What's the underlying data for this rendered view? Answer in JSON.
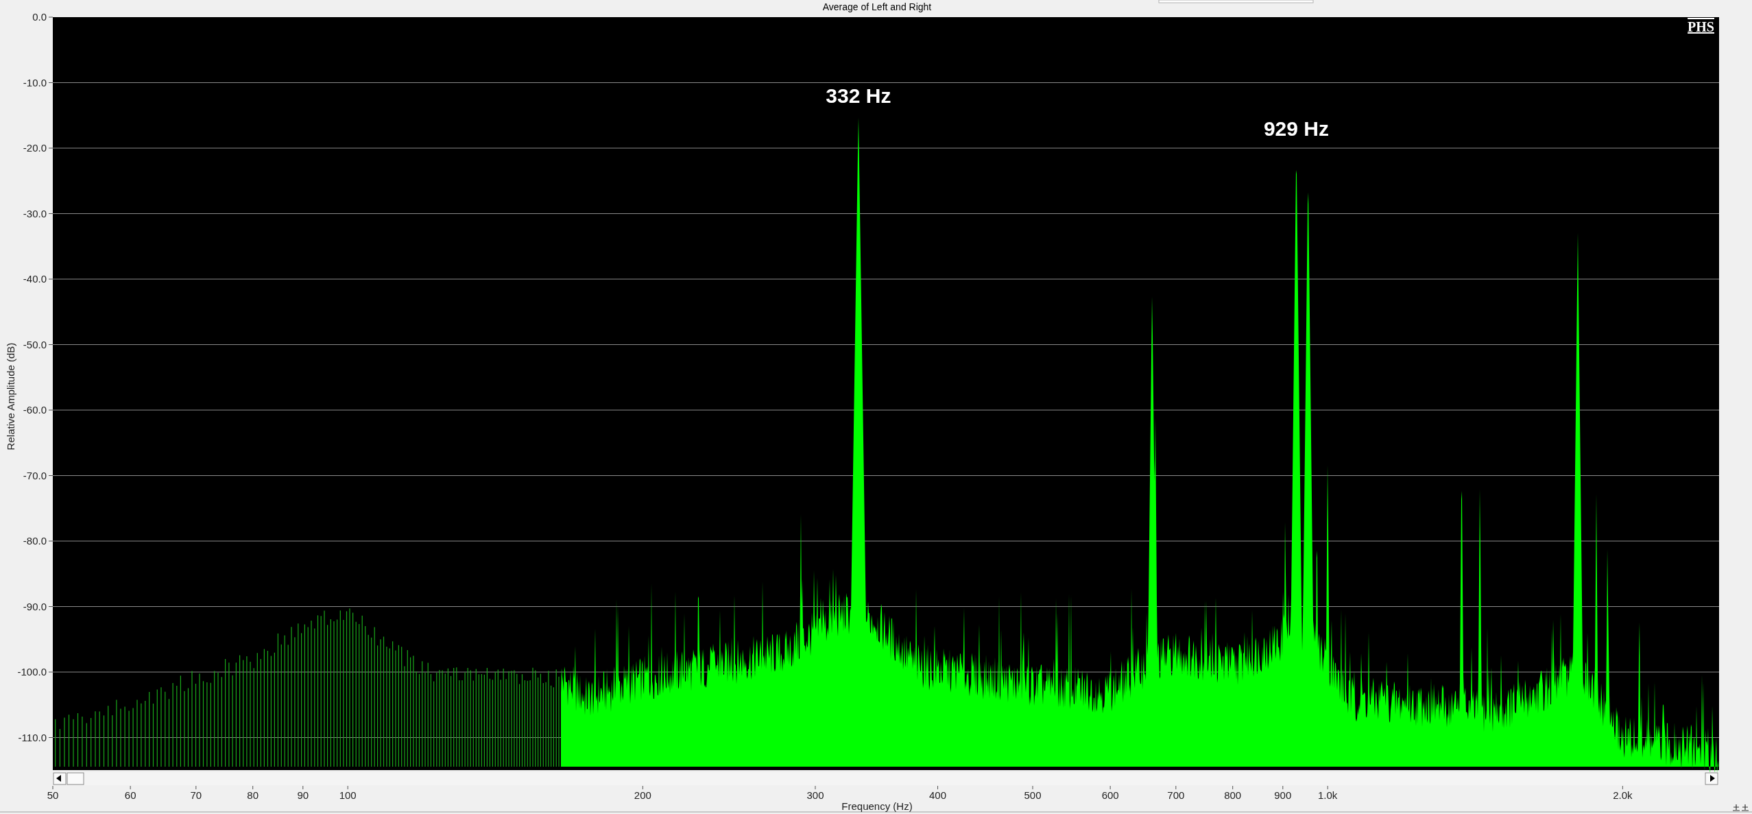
{
  "title": "Average of Left and Right",
  "logo": "PHS",
  "y_axis": {
    "label": "Relative Amplitude (dB)",
    "ticks": [
      "0.0",
      "-10.0",
      "-20.0",
      "-30.0",
      "-40.0",
      "-50.0",
      "-60.0",
      "-70.0",
      "-80.0",
      "-90.0",
      "-100.0",
      "-110.0"
    ]
  },
  "x_axis": {
    "label": "Frequency (Hz)",
    "ticks": [
      "50",
      "60",
      "70",
      "80",
      "90",
      "100",
      "200",
      "300",
      "400",
      "500",
      "600",
      "700",
      "800",
      "900",
      "1.0k",
      "2.0k"
    ]
  },
  "annotations": [
    "332 Hz",
    "929 Hz"
  ]
}
